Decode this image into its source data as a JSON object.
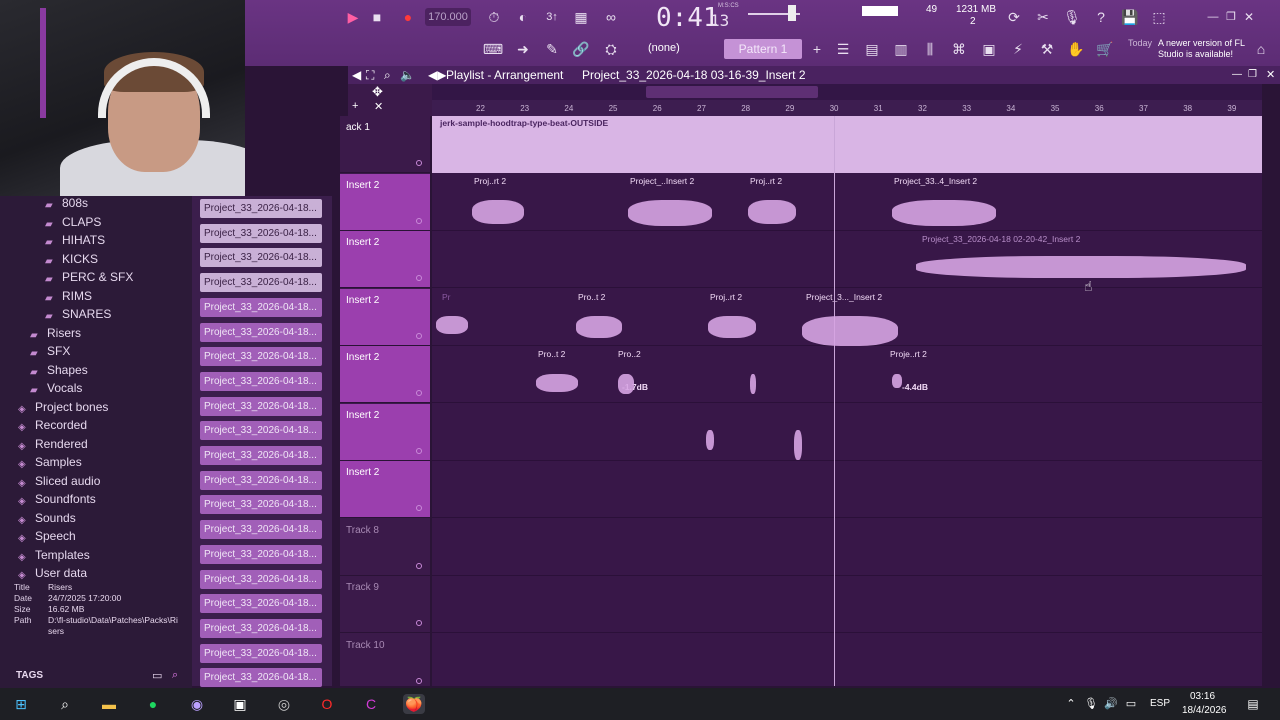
{
  "toolbar": {
    "tempo": "170.000",
    "time_main": "0:41",
    "time_sub": "13",
    "time_mode": "M:S:CS",
    "cpu_value": "49",
    "memory": "1231 MB",
    "poly": "2",
    "snap": "(none)",
    "pattern": "Pattern 1",
    "news_date": "Today",
    "news_text": "A newer version of FL Studio is available!"
  },
  "playlist": {
    "title": "Playlist - Arrangement",
    "breadcrumb": "Project_33_2026-04-18 03-16-39_Insert 2",
    "ruler": [
      "22",
      "23",
      "24",
      "25",
      "26",
      "27",
      "28",
      "29",
      "30",
      "31",
      "32",
      "33",
      "34",
      "35",
      "36",
      "37",
      "38",
      "39"
    ],
    "tracks": [
      {
        "name": "ack 1"
      },
      {
        "name": "Insert 2"
      },
      {
        "name": "Insert 2"
      },
      {
        "name": "Insert 2"
      },
      {
        "name": "Insert 2"
      },
      {
        "name": "Insert 2"
      },
      {
        "name": "Insert 2"
      },
      {
        "name": "Track 8"
      },
      {
        "name": "Track 9"
      },
      {
        "name": "Track 10"
      }
    ],
    "clip_labels": {
      "top": "jerk-sample-hoodtrap-type-beat-OUTSIDE",
      "l2a": "Proj..rt 2",
      "l2b": "Project_..Insert 2",
      "l2c": "Proj..rt 2",
      "l2d": "Project_33..4_Insert 2",
      "l3a": "Project_33_2026-04-18 02-20-42_Insert 2",
      "l4a": "Pr",
      "l4b": "Pro..t 2",
      "l4c": "Proj..rt 2",
      "l4d": "Project_3..._Insert 2",
      "l5a": "Pro..t 2",
      "l5b": "Pro..2",
      "l5c": "Proje..rt 2",
      "db1": "-1.7dB",
      "db2": "-4.4dB"
    }
  },
  "browser": {
    "items": [
      "808s",
      "CLAPS",
      "HIHATS",
      "KICKS",
      "PERC & SFX",
      "RIMS",
      "SNARES",
      "Risers",
      "SFX",
      "Shapes",
      "Vocals",
      "Project bones",
      "Recorded",
      "Rendered",
      "Samples",
      "Sliced audio",
      "Soundfonts",
      "Sounds",
      "Speech",
      "Templates",
      "User data"
    ],
    "info": {
      "title_k": "Title",
      "title_v": "Risers",
      "date_k": "Date",
      "date_v": "24/7/2025 17:20:00",
      "size_k": "Size",
      "size_v": "16.62 MB",
      "path_k": "Path",
      "path_v": "D:\\fl-studio\\Data\\Patches\\Packs\\Risers"
    },
    "tags": "TAGS"
  },
  "patterns": {
    "label": "Project_33_2026-04-18..."
  },
  "taskbar": {
    "lang": "ESP",
    "time": "03:16",
    "date": "18/4/2026"
  },
  "colors": {
    "accent": "#9b3fae",
    "background": "#381748",
    "clip": "#d6a4e2"
  }
}
